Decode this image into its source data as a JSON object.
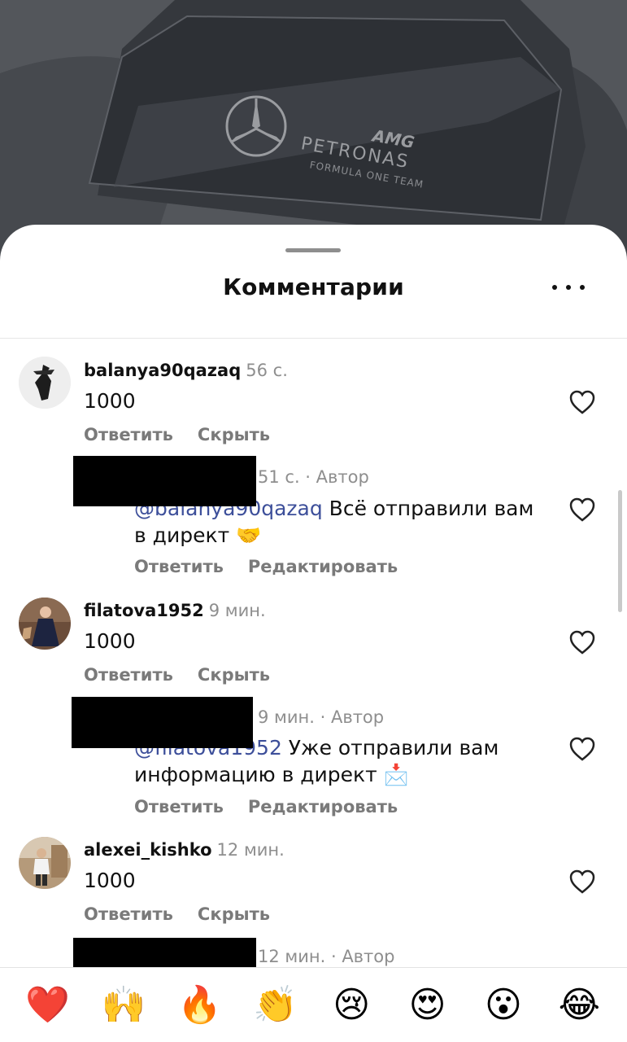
{
  "background": {
    "logo_text_1": "AMG",
    "logo_text_2": "PETRONAS",
    "logo_text_3": "FORMULA ONE TEAM"
  },
  "sheet": {
    "title": "Комментарии",
    "more_icon": "ellipsis-icon"
  },
  "comments": [
    {
      "username": "balanya90qazaq",
      "time": "56 с.",
      "text": "1000",
      "actions": [
        "Ответить",
        "Скрыть"
      ],
      "reply": {
        "time": "51 с. · Автор",
        "mention": "@balanya90qazaq",
        "text_line1": " Всё отправили вам",
        "text_line2": "в директ",
        "emoji": "🤝",
        "actions": [
          "Ответить",
          "Редактировать"
        ]
      }
    },
    {
      "username": "filatova1952",
      "time": "9 мин.",
      "text": "1000",
      "actions": [
        "Ответить",
        "Скрыть"
      ],
      "reply": {
        "time": "9 мин. · Автор",
        "mention": "@filatova1952",
        "text_line1": " Уже отправили вам",
        "text_line2": "информацию в директ",
        "emoji": "📩",
        "actions": [
          "Ответить",
          "Редактировать"
        ]
      }
    },
    {
      "username": "alexei_kishko",
      "time": "12 мин.",
      "text": "1000",
      "actions": [
        "Ответить",
        "Скрыть"
      ],
      "reply": {
        "time": "12 мин. · Автор"
      }
    }
  ],
  "reactions": [
    "❤️",
    "🙌",
    "🔥",
    "👏",
    "😢",
    "😍",
    "😮",
    "😂"
  ],
  "colors": {
    "mention": "#3d4f9a",
    "muted": "#8e8e8e",
    "text": "#111111"
  }
}
